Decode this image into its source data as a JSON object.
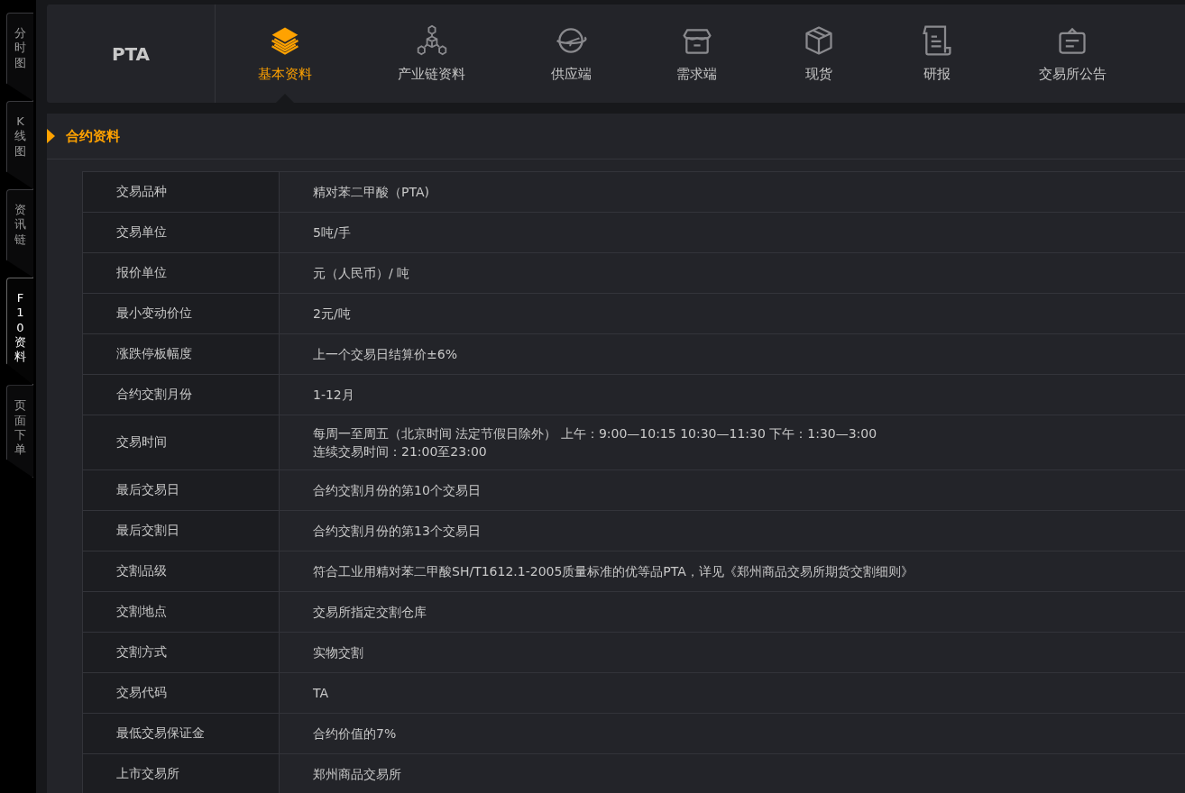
{
  "side_tabs": [
    {
      "label": "分时图",
      "selected": false
    },
    {
      "label": "K线图",
      "selected": false
    },
    {
      "label": "资讯链",
      "selected": false
    },
    {
      "label": "F10资料",
      "selected": true
    },
    {
      "label": "页面下单",
      "selected": false
    }
  ],
  "product": "PTA",
  "nav": [
    {
      "label": "基本资料",
      "kind": "layers",
      "selected": true
    },
    {
      "label": "产业链资料",
      "kind": "chain",
      "selected": false
    },
    {
      "label": "供应端",
      "kind": "plane",
      "selected": false
    },
    {
      "label": "需求端",
      "kind": "store",
      "selected": false
    },
    {
      "label": "现货",
      "kind": "box",
      "selected": false
    },
    {
      "label": "研报",
      "kind": "scroll",
      "selected": false
    },
    {
      "label": "交易所公告",
      "kind": "notice",
      "selected": false
    }
  ],
  "section_title": "合约资料",
  "rows": [
    {
      "label": "交易品种",
      "value": [
        "精对苯二甲酸（PTA)"
      ]
    },
    {
      "label": "交易单位",
      "value": [
        "5吨/手"
      ]
    },
    {
      "label": "报价单位",
      "value": [
        "元（人民币）/ 吨"
      ]
    },
    {
      "label": "最小变动价位",
      "value": [
        "2元/吨"
      ]
    },
    {
      "label": "涨跌停板幅度",
      "value": [
        "上一个交易日结算价±6%"
      ]
    },
    {
      "label": "合约交割月份",
      "value": [
        "1-12月"
      ]
    },
    {
      "label": "交易时间",
      "value": [
        "每周一至周五（北京时间 法定节假日除外） 上午：9:00—10:15 10:30—11:30 下午：1:30—3:00",
        "连续交易时间：21:00至23:00"
      ]
    },
    {
      "label": "最后交易日",
      "value": [
        "合约交割月份的第10个交易日"
      ]
    },
    {
      "label": "最后交割日",
      "value": [
        "合约交割月份的第13个交易日"
      ]
    },
    {
      "label": "交割品级",
      "value": [
        "符合工业用精对苯二甲酸SH/T1612.1-2005质量标准的优等品PTA，详见《郑州商品交易所期货交割细则》"
      ]
    },
    {
      "label": "交割地点",
      "value": [
        "交易所指定交割仓库"
      ]
    },
    {
      "label": "交割方式",
      "value": [
        "实物交割"
      ]
    },
    {
      "label": "交易代码",
      "value": [
        "TA"
      ]
    },
    {
      "label": "最低交易保证金",
      "value": [
        "合约价值的7%"
      ]
    },
    {
      "label": "上市交易所",
      "value": [
        "郑州商品交易所"
      ]
    }
  ]
}
